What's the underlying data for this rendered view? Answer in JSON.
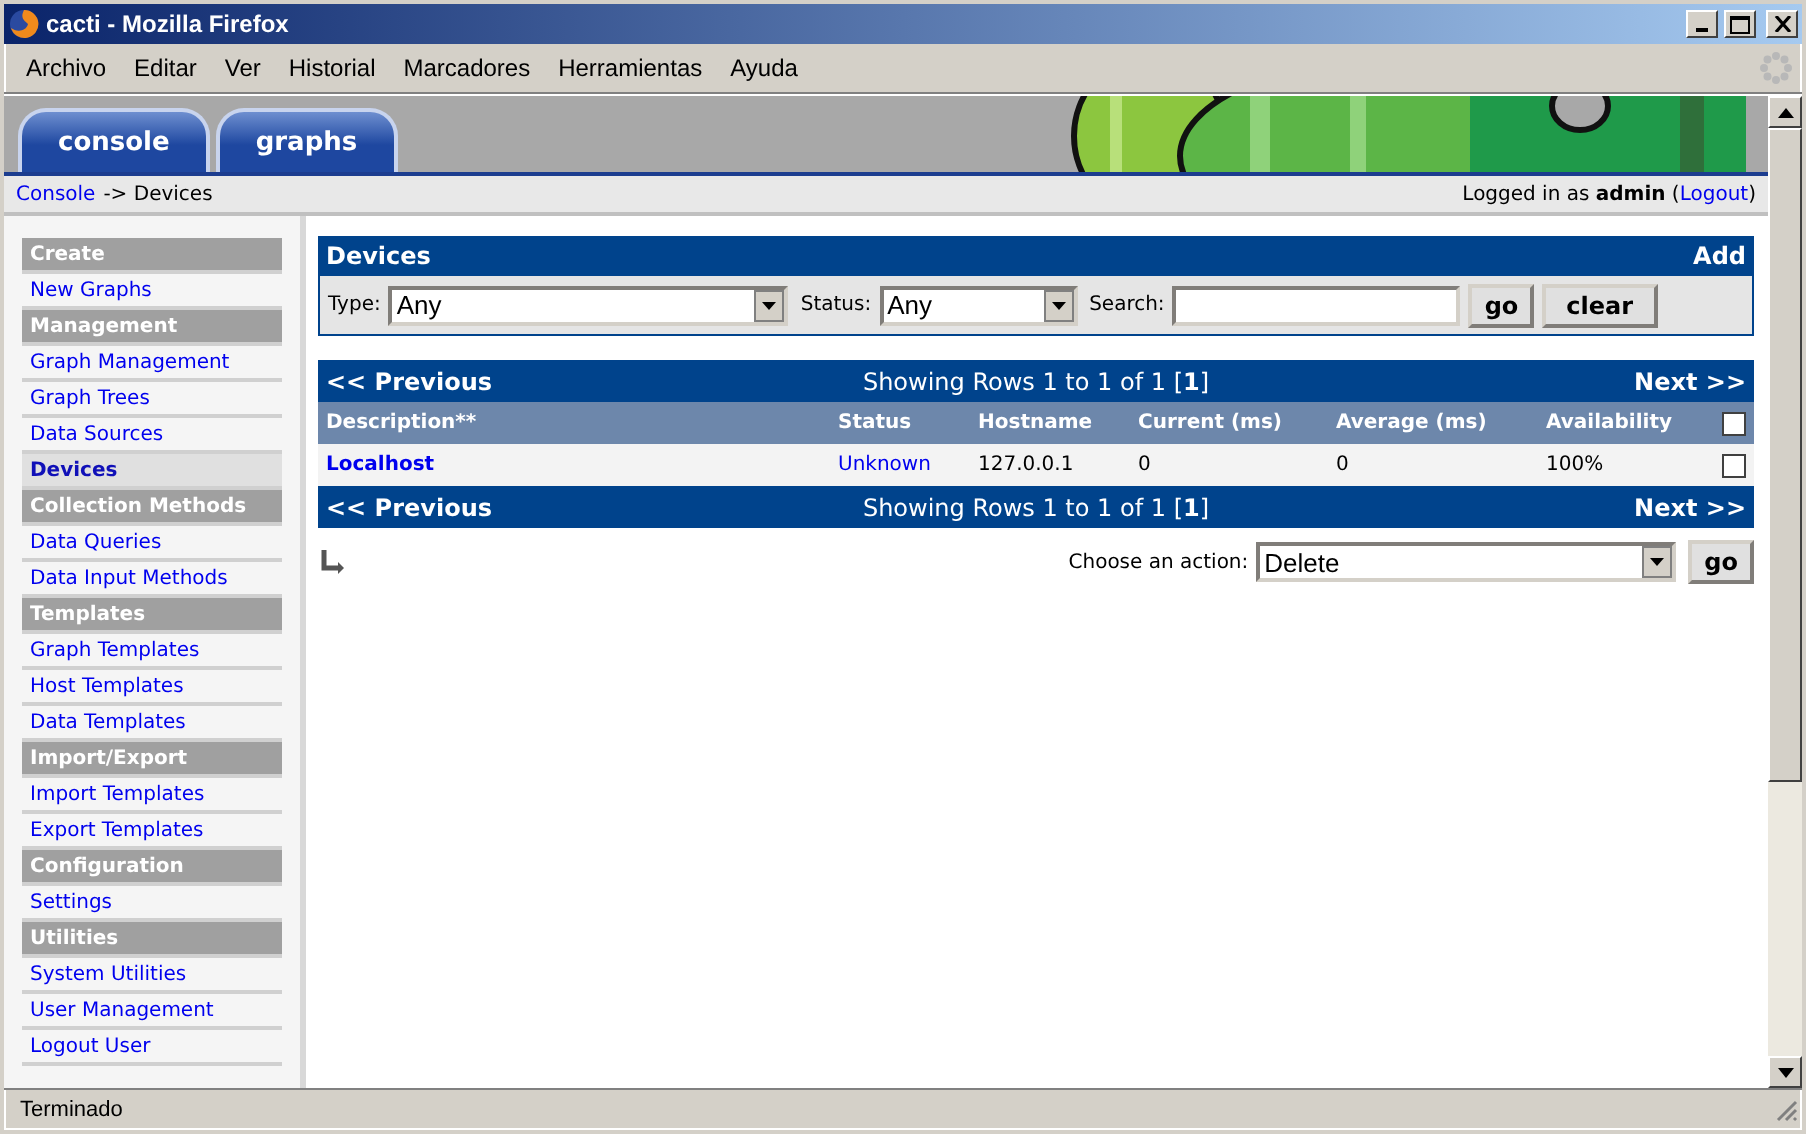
{
  "window": {
    "title": "cacti - Mozilla Firefox"
  },
  "menu": [
    "Archivo",
    "Editar",
    "Ver",
    "Historial",
    "Marcadores",
    "Herramientas",
    "Ayuda"
  ],
  "tabs": [
    {
      "label": "console"
    },
    {
      "label": "graphs"
    }
  ],
  "breadcrumb": {
    "link": "Console",
    "current": "-> Devices"
  },
  "login": {
    "text": "Logged in as **admin** (",
    "link": "Logout",
    "after": ")"
  },
  "sidebar": [
    {
      "heading": "Create",
      "items": [
        {
          "label": "New Graphs",
          "selected": false
        }
      ]
    },
    {
      "heading": "Management",
      "items": [
        {
          "label": "Graph Management",
          "selected": false
        },
        {
          "label": "Graph Trees",
          "selected": false
        },
        {
          "label": "Data Sources",
          "selected": false
        },
        {
          "label": "Devices",
          "selected": true
        }
      ]
    },
    {
      "heading": "Collection Methods",
      "items": [
        {
          "label": "Data Queries",
          "selected": false
        },
        {
          "label": "Data Input Methods",
          "selected": false
        }
      ]
    },
    {
      "heading": "Templates",
      "items": [
        {
          "label": "Graph Templates",
          "selected": false
        },
        {
          "label": "Host Templates",
          "selected": false
        },
        {
          "label": "Data Templates",
          "selected": false
        }
      ]
    },
    {
      "heading": "Import/Export",
      "items": [
        {
          "label": "Import Templates",
          "selected": false
        },
        {
          "label": "Export Templates",
          "selected": false
        }
      ]
    },
    {
      "heading": "Configuration",
      "items": [
        {
          "label": "Settings",
          "selected": false
        }
      ]
    },
    {
      "heading": "Utilities",
      "items": [
        {
          "label": "System Utilities",
          "selected": false
        },
        {
          "label": "User Management",
          "selected": false
        },
        {
          "label": "Logout User",
          "selected": false
        }
      ]
    }
  ],
  "panel": {
    "title": "Devices",
    "add": "Add",
    "type_label": "Type:",
    "type_value": "Any",
    "status_label": "Status:",
    "status_value": "Any",
    "search_label": "Search:",
    "go": "go",
    "clear": "clear"
  },
  "table": {
    "nav_top": {
      "previous": "<< Previous",
      "showing": "Showing Rows 1 to 1 of 1 [**1**]",
      "next": "Next >>"
    },
    "columns": [
      "Description**",
      "Status",
      "Hostname",
      "Current (ms)",
      "Average (ms)",
      "Availability"
    ],
    "select_all": {
      "checked": false
    },
    "rows": [
      {
        "cells": [
          "Localhost",
          "Unknown",
          "127.0.0.1",
          "0",
          "0",
          "100%"
        ],
        "checked": false
      }
    ],
    "nav_bottom": {
      "previous": "<< Previous",
      "showing": "Showing Rows 1 to 1 of 1 [**1**]",
      "next": "Next >>"
    }
  },
  "action": {
    "label": "Choose an action:",
    "value": "Delete",
    "go": "go"
  },
  "status_bar": "Terminado"
}
